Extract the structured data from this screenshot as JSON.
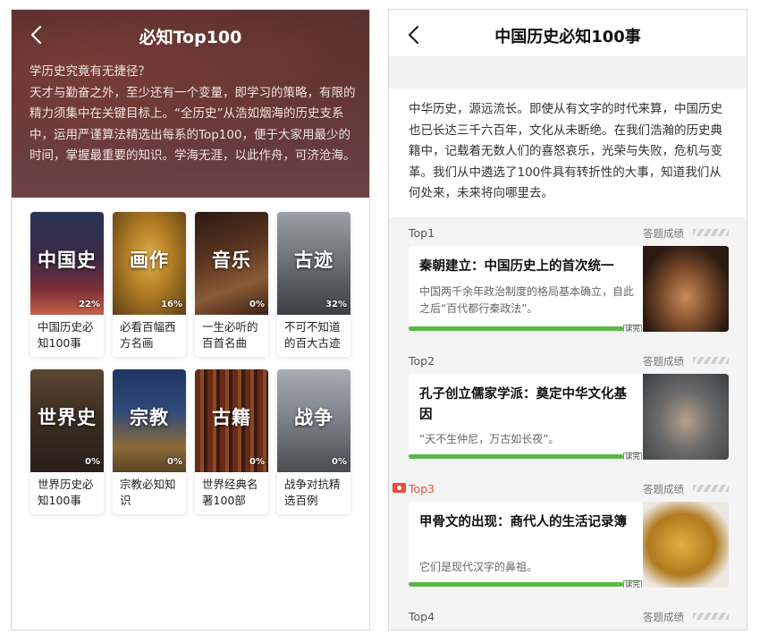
{
  "left": {
    "title": "必知Top100",
    "intro": "学历史究竟有无捷径？\n天才与勤奋之外，至少还有一个变量，即学习的策略，有限的精力须集中在关键目标上。“全历史”从浩如烟海的历史支系中，运用严谨算法精选出每系的Top100，便于大家用最少的时间，掌握最重要的知识。学海无涯，以此作舟，可济沧海。",
    "cards": [
      {
        "cover": "中国史",
        "pct": "22%",
        "name": "中国历史必知100事"
      },
      {
        "cover": "画作",
        "pct": "16%",
        "name": "必看百幅西方名画"
      },
      {
        "cover": "音乐",
        "pct": "0%",
        "name": "一生必听的百首名曲"
      },
      {
        "cover": "古迹",
        "pct": "32%",
        "name": "不可不知道的百大古迹"
      },
      {
        "cover": "世界史",
        "pct": "0%",
        "name": "世界历史必知100事"
      },
      {
        "cover": "宗教",
        "pct": "0%",
        "name": "宗教必知知识"
      },
      {
        "cover": "古籍",
        "pct": "0%",
        "name": "世界经典名著100部"
      },
      {
        "cover": "战争",
        "pct": "0%",
        "name": "战争对抗精选百例"
      }
    ]
  },
  "right": {
    "title": "中国历史必知100事",
    "intro": "中华历史，源远流长。即使从有文字的时代来算，中国历史也已长达三千六百年，文化从未断绝。在我们浩瀚的历史典籍中，记载着无数人们的喜怒哀乐，光荣与失败，危机与变革。我们从中遴选了100件具有转折性的大事，知道我们从何处来，未来将向哪里去。",
    "score_label": "答题成绩",
    "read_label": "读完",
    "entries": [
      {
        "rank": "Top1",
        "title": "秦朝建立：中国历史上的首次统一",
        "desc": "中国两千余年政治制度的格局基本确立，自此之后“百代都行秦政法”。"
      },
      {
        "rank": "Top2",
        "title": "孔子创立儒家学派：奠定中华文化基因",
        "desc": "“天不生仲尼，万古如长夜”。"
      },
      {
        "rank": "Top3",
        "title": "甲骨文的出现：商代人的生活记录簿",
        "desc": "它们是现代汉字的鼻祖。"
      },
      {
        "rank": "Top4",
        "title": "",
        "desc": ""
      }
    ]
  },
  "colors": {
    "accent_green": "#58b947",
    "hot_red": "#e84d3d",
    "hero_bg": "#5a3434"
  },
  "icons": {
    "back": "chevron-left-icon",
    "hot": "hot-tag-icon"
  }
}
